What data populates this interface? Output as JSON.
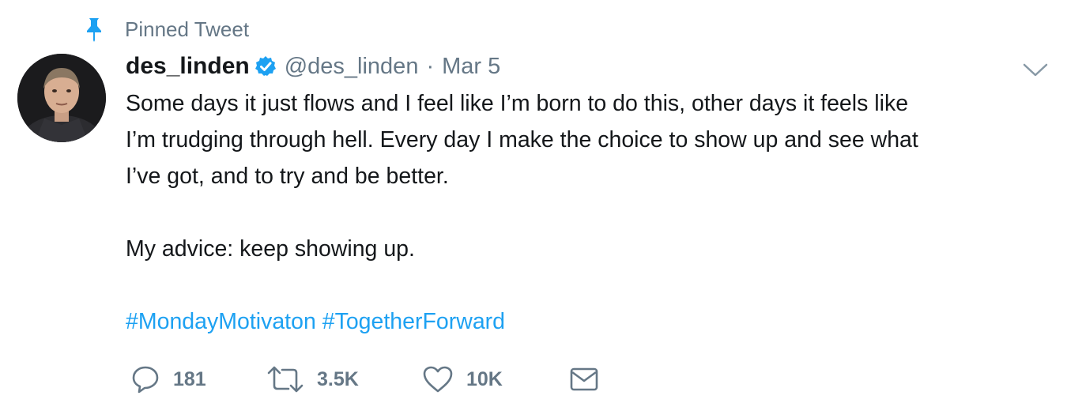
{
  "pinned": {
    "label": "Pinned Tweet",
    "icon": "pin-icon"
  },
  "author": {
    "display_name": "des_linden",
    "verified_icon": "verified-badge-icon",
    "handle": "@des_linden",
    "separator": "·",
    "date": "Mar 5",
    "avatar": "avatar"
  },
  "menu": {
    "icon": "chevron-down-icon"
  },
  "tweet": {
    "lines": [
      "Some days it just flows and I feel like I’m born to do this, other days it feels like",
      "I’m trudging through hell. Every day I make the choice to show up and see what",
      "I’ve got, and to try and be better.",
      "My advice: keep showing up."
    ],
    "hashtags": [
      "#MondayMotivaton",
      "#TogetherForward"
    ]
  },
  "actions": {
    "reply": {
      "icon": "reply-icon",
      "count": "181"
    },
    "retweet": {
      "icon": "retweet-icon",
      "count": "3.5K"
    },
    "like": {
      "icon": "heart-icon",
      "count": "10K"
    },
    "dm": {
      "icon": "envelope-icon"
    }
  },
  "colors": {
    "accent": "#1da1f2",
    "secondary_text": "#657786",
    "primary_text": "#14171a"
  }
}
